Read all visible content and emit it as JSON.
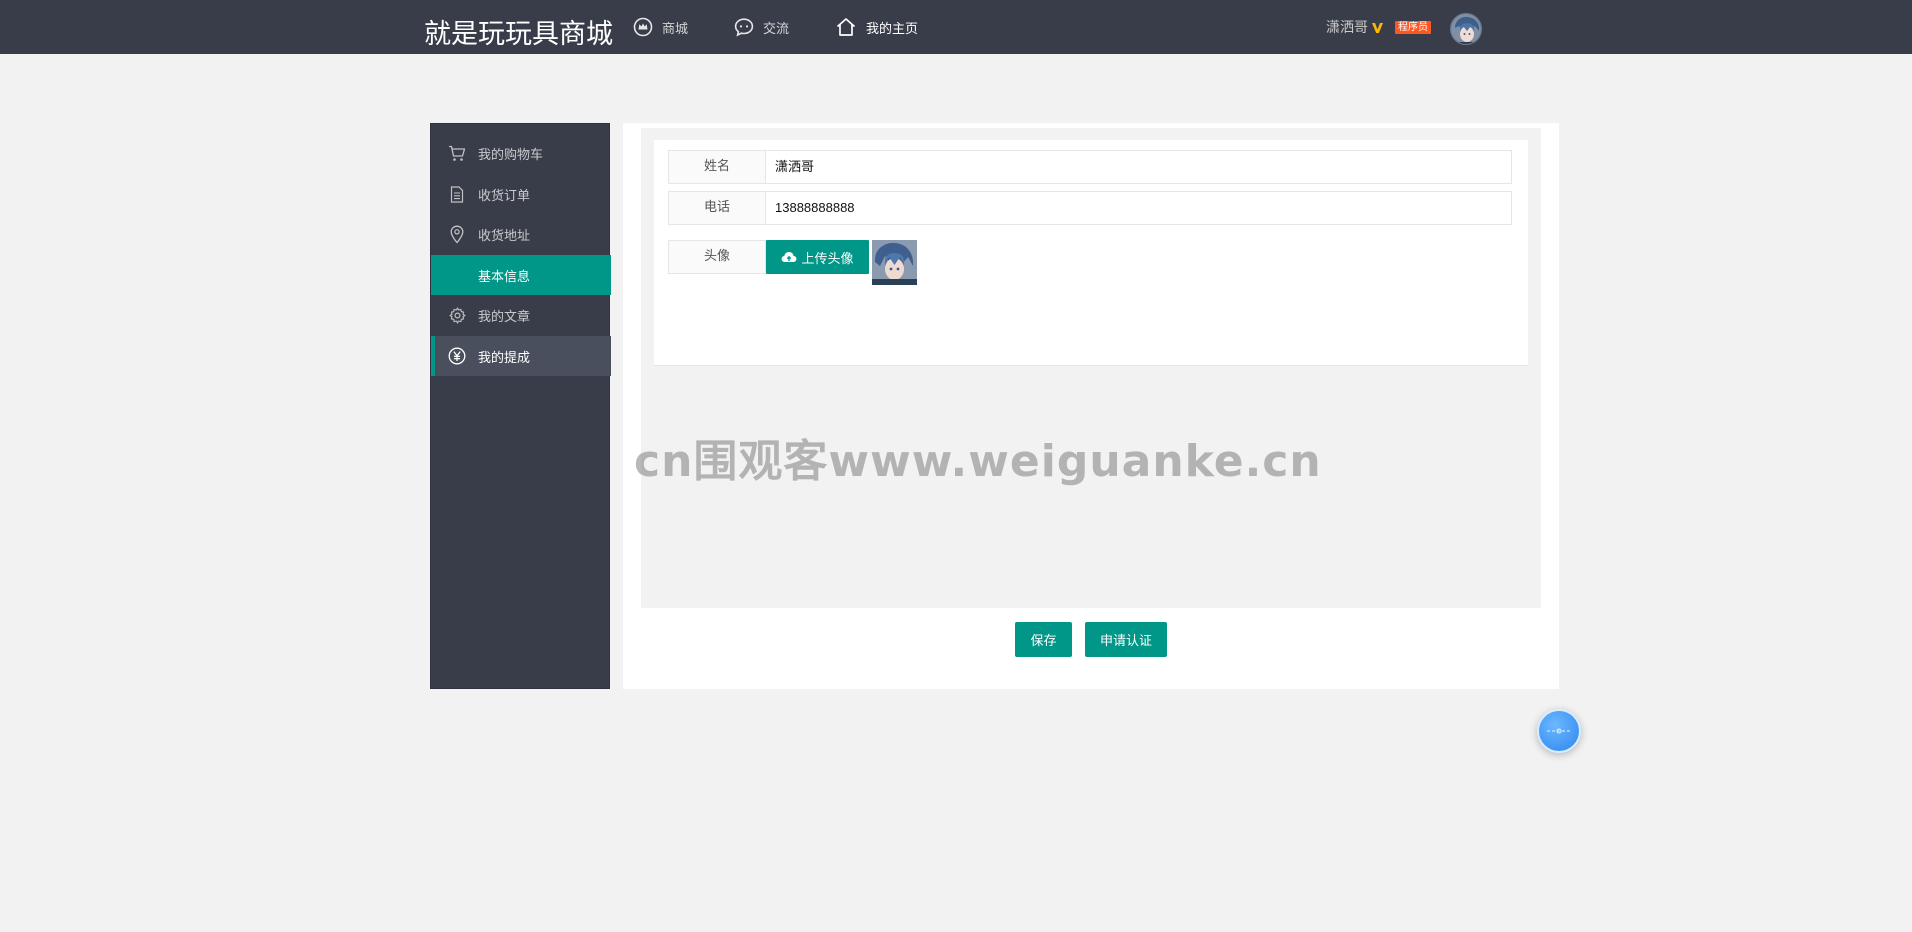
{
  "header": {
    "logo": "就是玩玩具商城",
    "nav": [
      {
        "label": "商城",
        "icon": "crown-icon"
      },
      {
        "label": "交流",
        "icon": "chat-bubble-icon"
      },
      {
        "label": "我的主页",
        "icon": "home-icon"
      }
    ],
    "user": {
      "name": "潇洒哥",
      "vip_icon": "vip-v-icon",
      "role": "程序员"
    }
  },
  "sidebar": {
    "items": [
      {
        "label": "我的购物车",
        "icon": "cart-icon"
      },
      {
        "label": "收货订单",
        "icon": "document-icon"
      },
      {
        "label": "收货地址",
        "icon": "location-pin-icon"
      },
      {
        "label": "基本信息",
        "icon": "",
        "state": "active"
      },
      {
        "label": "我的文章",
        "icon": "gear-icon"
      },
      {
        "label": "我的提成",
        "icon": "yen-circle-icon",
        "state": "hover"
      }
    ]
  },
  "form": {
    "name_label": "姓名",
    "name_value": "潇洒哥",
    "phone_label": "电话",
    "phone_value": "13888888888",
    "avatar_label": "头像",
    "upload_label": "上传头像"
  },
  "actions": {
    "save_label": "保存",
    "certify_label": "申请认证"
  },
  "watermark": "cn围观客www.weiguanke.cn",
  "colors": {
    "header_bg": "#393d49",
    "accent": "#009688",
    "badge": "#ff5722",
    "page_bg": "#f2f2f2"
  }
}
